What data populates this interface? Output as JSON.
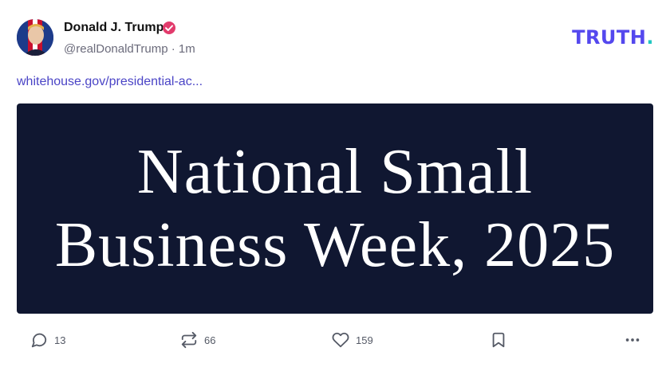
{
  "post": {
    "author_name": "Donald J. Trump",
    "handle": "@realDonaldTrump",
    "separator": "·",
    "time": "1m",
    "link_text": "whitehouse.gov/presidential-ac...",
    "image_text_line1": "National Small",
    "image_text_line2": "Business Week, 2025"
  },
  "brand": {
    "name": "TRUTH",
    "dot": ".",
    "color": "#5448ee",
    "dot_color": "#22c7c2"
  },
  "actions": {
    "replies": "13",
    "retruths": "66",
    "likes": "159"
  },
  "icons": [
    "verified-badge-icon",
    "reply-icon",
    "retruth-icon",
    "like-icon",
    "bookmark-icon",
    "more-icon"
  ]
}
